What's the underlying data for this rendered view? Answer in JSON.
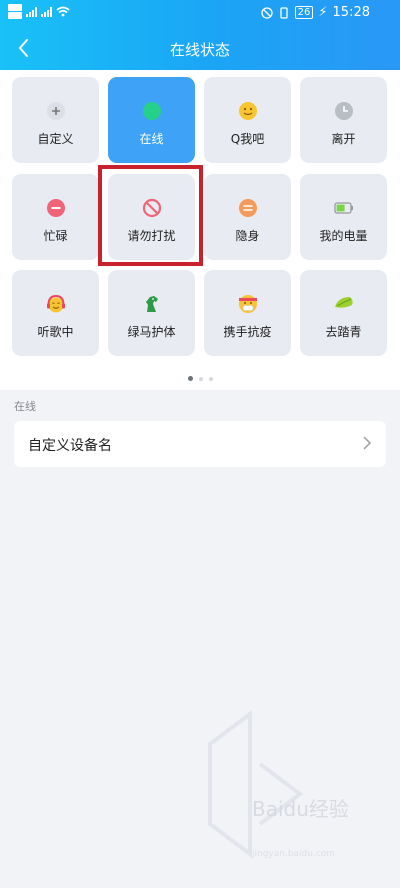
{
  "status_bar": {
    "sim1": "HD1",
    "sim2": "HD2",
    "net1": "4G",
    "net2": "4G",
    "battery": "26",
    "time": "15:28"
  },
  "header": {
    "title": "在线状态"
  },
  "status_tiles": [
    {
      "label": "自定义",
      "icon": "plus-icon",
      "color": "#dcdfe5",
      "active": false
    },
    {
      "label": "在线",
      "icon": "online-dot-icon",
      "color": "#25d18a",
      "active": true
    },
    {
      "label": "Q我吧",
      "icon": "smile-emoji-icon",
      "color": "#f7c531",
      "active": false
    },
    {
      "label": "离开",
      "icon": "clock-icon",
      "color": "#b9bdc5",
      "active": false
    },
    {
      "label": "忙碌",
      "icon": "minus-icon",
      "color": "#f06577",
      "active": false
    },
    {
      "label": "请勿打扰",
      "icon": "do-not-disturb-icon",
      "color": "#f06577",
      "active": false
    },
    {
      "label": "隐身",
      "icon": "invisible-icon",
      "color": "#f49a5a",
      "active": false
    },
    {
      "label": "我的电量",
      "icon": "battery-icon",
      "color": "#7cd44b",
      "active": false
    },
    {
      "label": "听歌中",
      "icon": "headphone-emoji-icon",
      "color": "#f2a43a",
      "active": false
    },
    {
      "label": "绿马护体",
      "icon": "green-horse-icon",
      "color": "#2e9a45",
      "active": false
    },
    {
      "label": "携手抗疫",
      "icon": "mask-emoji-icon",
      "color": "#f6c33b",
      "active": false
    },
    {
      "label": "去踏青",
      "icon": "leaf-hat-icon",
      "color": "#9bd02e",
      "active": false
    }
  ],
  "pager": {
    "current": 1,
    "total": 3
  },
  "section": {
    "label": "在线"
  },
  "settings_row": {
    "label": "自定义设备名"
  },
  "watermark": {
    "text": "Baidu经验",
    "sub": "jingyan.baidu.com"
  }
}
